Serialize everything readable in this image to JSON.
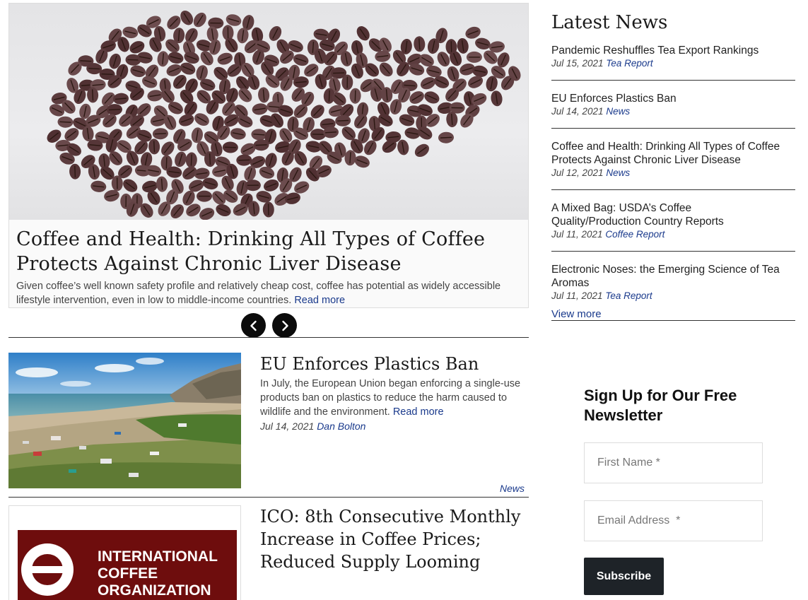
{
  "hero": {
    "title": "Coffee and Health: Drinking All Types of Coffee Protects Against Chronic Liver Disease",
    "summary": "Given coffee’s well known safety profile and relatively cheap cost, coffee has potential as widely accessible lifestyle intervention, even in low to middle-income countries.",
    "read_more": "Read more"
  },
  "carousel": {
    "prev_icon": "chevron-left-icon",
    "next_icon": "chevron-right-icon"
  },
  "articles": [
    {
      "title": "EU Enforces Plastics Ban",
      "summary": "In July, the European Union began enforcing a single-use products ban on plastics to reduce the harm caused to wildlife and the environment.",
      "read_more": "Read more",
      "date": "Jul 14, 2021",
      "author": "Dan Bolton",
      "category": "News"
    },
    {
      "title": "ICO: 8th Consecutive Monthly Increase in Coffee Prices; Reduced Supply Looming",
      "logo_line1": "INTERNATIONAL",
      "logo_line2": "COFFEE",
      "logo_line3": "ORGANIZATION"
    }
  ],
  "latest": {
    "heading": "Latest News",
    "items": [
      {
        "title": "Pandemic Reshuffles Tea Export Rankings",
        "date": "Jul 15, 2021",
        "category": "Tea Report"
      },
      {
        "title": "EU Enforces Plastics Ban",
        "date": "Jul 14, 2021",
        "category": "News"
      },
      {
        "title": "Coffee and Health: Drinking All Types of Coffee Protects Against Chronic Liver Disease",
        "date": "Jul 12, 2021",
        "category": "News"
      },
      {
        "title": "A Mixed Bag: USDA’s Coffee Quality/Production Country Reports",
        "date": "Jul 11, 2021",
        "category": "Coffee Report"
      },
      {
        "title": "Electronic Noses: the Emerging Science of Tea Aromas",
        "date": "Jul 11, 2021",
        "category": "Tea Report"
      }
    ],
    "view_more": "View more"
  },
  "newsletter": {
    "heading": "Sign Up for Our Free Newsletter",
    "first_name_placeholder": "First Name *",
    "email_placeholder": "Email Address  *",
    "subscribe": "Subscribe"
  },
  "colors": {
    "link": "#1a3a8c",
    "button_dark": "#1e2328",
    "ico_red": "#6e0d0d"
  }
}
